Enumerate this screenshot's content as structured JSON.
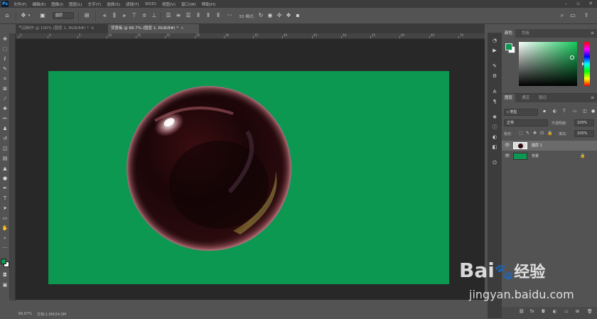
{
  "app": {
    "logo": "Ps"
  },
  "menu": [
    "文件(F)",
    "编辑(E)",
    "图像(I)",
    "图层(L)",
    "文字(Y)",
    "选择(S)",
    "滤镜(T)",
    "3D(D)",
    "视图(V)",
    "窗口(W)",
    "帮助(H)"
  ],
  "options": {
    "auto_select_value": "图层",
    "mode_label": "3D 模式:"
  },
  "tabs": [
    {
      "label": "气泡制作 @ 100% (图层 1, RGB/8#) *",
      "active": false
    },
    {
      "label": "背景板 @ 66.7% (图层 1, RGB/8#) *",
      "active": true
    }
  ],
  "ruler_labels": [
    "5",
    "0",
    "5",
    "10",
    "15",
    "20",
    "25",
    "30",
    "35",
    "40",
    "45",
    "50",
    "55",
    "60",
    "65",
    "70"
  ],
  "colors": {
    "canvas": "#0c9850",
    "foreground": "#0c9850",
    "background": "#ffffff"
  },
  "color_panel": {
    "tabs": [
      "颜色",
      "色板"
    ]
  },
  "layers_panel": {
    "tabs": [
      "图层",
      "通道",
      "路径"
    ],
    "filter_label": "类型",
    "blend_mode": "正常",
    "opacity_label": "不透明度:",
    "opacity_value": "100%",
    "lock_label": "锁定:",
    "fill_label": "填充:",
    "fill_value": "100%",
    "layers": [
      {
        "name": "图层 1",
        "selected": true
      },
      {
        "name": "背景",
        "selected": false,
        "locked": true
      }
    ]
  },
  "status": {
    "zoom": "66.67%",
    "doc_info": "文档:2.6M/24.0M"
  },
  "watermark": {
    "brand": "Bai",
    "brand_suffix": "经验",
    "url": "jingyan.baidu.com"
  }
}
